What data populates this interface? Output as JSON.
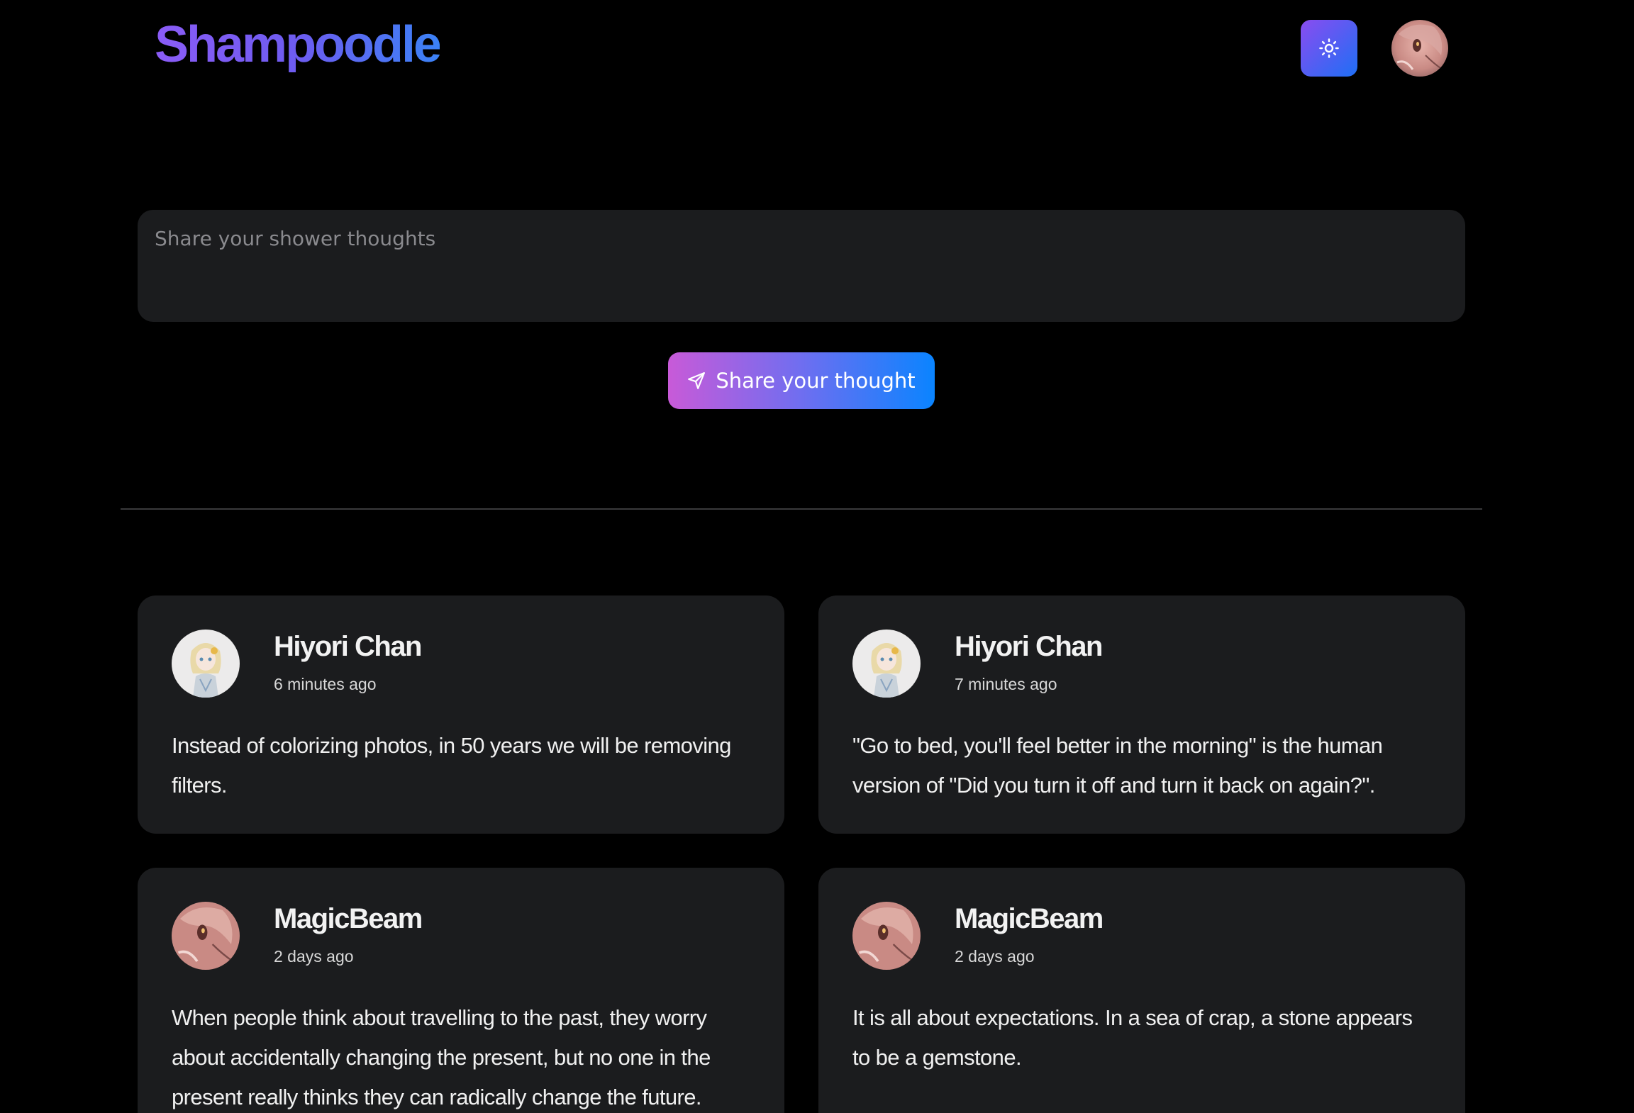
{
  "header": {
    "logo": "Shampoodle",
    "theme_toggle_icon": "sun-icon",
    "user_avatar": "avatar-magicbeam"
  },
  "composer": {
    "placeholder": "Share your shower thoughts",
    "value": "",
    "button_label": "Share your thought",
    "button_icon": "send-icon"
  },
  "colors": {
    "background": "#000000",
    "card": "#1b1c1e",
    "accent_start": "#c85ad8",
    "accent_end": "#0a84ff"
  },
  "posts": [
    {
      "author": "Hiyori Chan",
      "time": "6 minutes ago",
      "text": "Instead of colorizing photos, in 50 years we will be removing filters."
    },
    {
      "author": "Hiyori Chan",
      "time": "7 minutes ago",
      "text": "\"Go to bed, you'll feel better in the morning\" is the human version of \"Did you turn it off and turn it back on again?\"."
    },
    {
      "author": "MagicBeam",
      "time": "2 days ago",
      "text": "When people think about travelling to the past, they worry about accidentally changing the present, but no one in the present really thinks they can radically change the future."
    },
    {
      "author": "MagicBeam",
      "time": "2 days ago",
      "text": "It is all about expectations. In a sea of crap, a stone appears to be a gemstone."
    }
  ]
}
